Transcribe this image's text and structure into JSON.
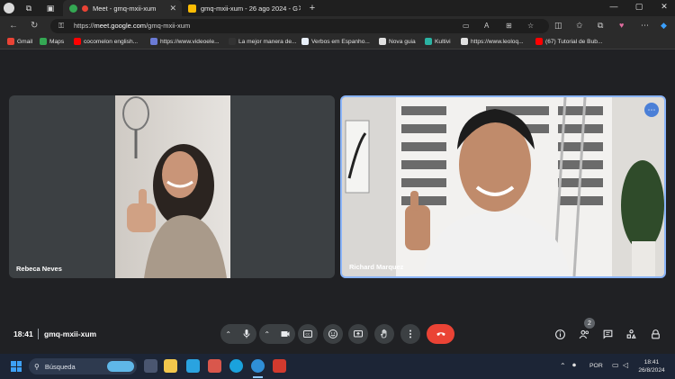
{
  "browser": {
    "tabs": [
      {
        "title": "Meet - gmq-mxii-xum",
        "active": true
      },
      {
        "title": "gmq-mxii-xum - 26 ago 2024 - G",
        "active": false
      }
    ],
    "new_tab": "+",
    "close": "✕",
    "address_bar": {
      "url_prefix": "https://",
      "url_host": "meet.google.com",
      "url_path": "/gmq-mxii-xum"
    },
    "bookmarks": [
      {
        "label": "Gmail",
        "color": "#ea4335"
      },
      {
        "label": "Maps",
        "color": "#34a853"
      },
      {
        "label": "cocomelon english...",
        "color": "#ff0000"
      },
      {
        "label": "https://www.videoele...",
        "color": "#6b7bd6"
      },
      {
        "label": "La mejor manera de...",
        "color": "#333333"
      },
      {
        "label": "Verbos em Espanho...",
        "color": "#e9f0fb"
      },
      {
        "label": "Nova guia",
        "color": "#e0e0e0"
      },
      {
        "label": "Kultivi",
        "color": "#2bb3a3"
      },
      {
        "label": "https://www.leoloq...",
        "color": "#e0e0e0"
      },
      {
        "label": "(67) Tutorial de Bub...",
        "color": "#ff0000"
      }
    ]
  },
  "meet": {
    "participants": [
      {
        "name": "Rebeca Neves"
      },
      {
        "name": "Richard Marquez"
      }
    ],
    "clock": "18:41",
    "meeting_code": "gmq-mxii-xum",
    "people_count": "2",
    "end_call_color": "#ea4335",
    "accent": "#8ab4f8"
  },
  "taskbar": {
    "search_label": "Búsqueda",
    "language": "POR",
    "time": "18:41",
    "date": "26/8/2024"
  }
}
